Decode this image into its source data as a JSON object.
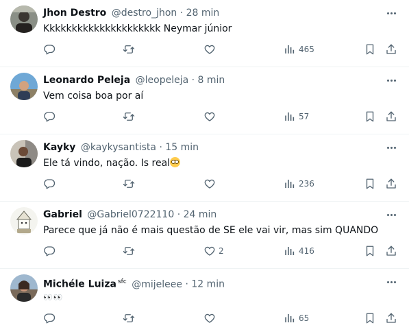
{
  "colors": {
    "text": "#0f1419",
    "secondary": "#536471",
    "divider": "#eff3f4"
  },
  "icons": {
    "more": "more-horizontal-icon",
    "reply": "reply-icon",
    "retweet": "retweet-icon",
    "like": "heart-icon",
    "views": "views-bar-chart-icon",
    "bookmark": "bookmark-icon",
    "share": "share-icon"
  },
  "tweets": [
    {
      "name": "Jhon Destro",
      "handle": "@destro_jhon",
      "separator": "·",
      "time": "28 min",
      "text": "Kkkkkkkkkkkkkkkkkkkkk Neymar júnior",
      "likes": "",
      "views": "465"
    },
    {
      "name": "Leonardo Peleja",
      "handle": "@leopeleja",
      "separator": "·",
      "time": "8 min",
      "text": "Vem coisa boa por aí",
      "likes": "",
      "views": "57"
    },
    {
      "name": "Kayky",
      "handle": "@kaykysantista",
      "separator": "·",
      "time": "15 min",
      "text": "Ele tá vindo, nação. Is real",
      "likes": "",
      "views": "236"
    },
    {
      "name": "Gabriel",
      "handle": "@Gabriel0722110",
      "separator": "·",
      "time": "24 min",
      "text": "Parece que já não é mais questão de SE ele vai vir, mas sim QUANDO",
      "likes": "2",
      "views": "416"
    },
    {
      "name": "Michéle Luiza",
      "badge": "sfc",
      "handle": "@mijeleee",
      "separator": "·",
      "time": "12 min",
      "text": "👀👀",
      "likes": "",
      "views": "65"
    }
  ]
}
